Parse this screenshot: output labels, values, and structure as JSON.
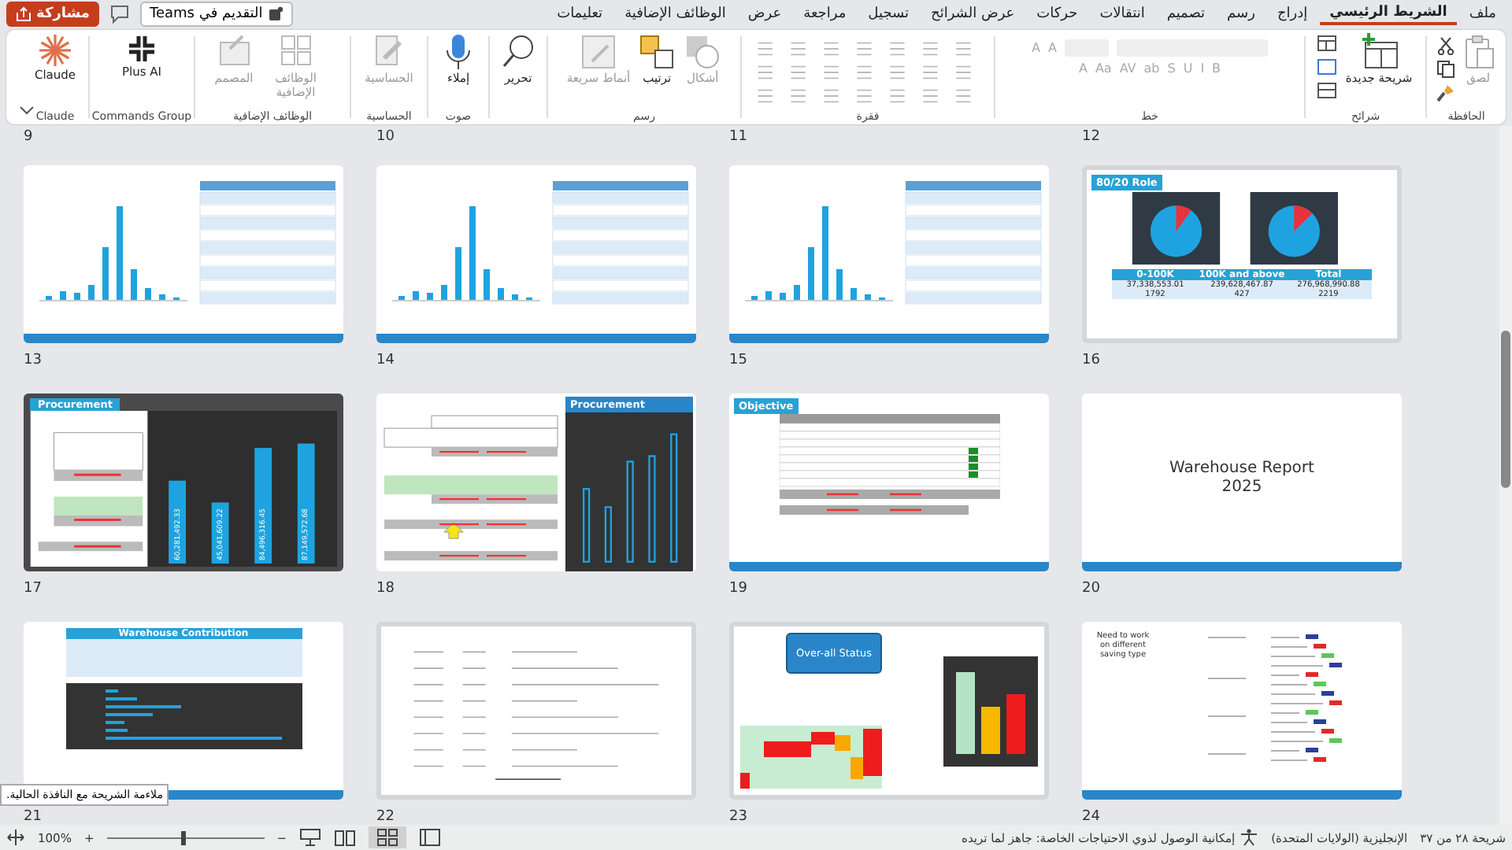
{
  "title_bar": {
    "share": "مشاركة",
    "teams": "التقديم في Teams"
  },
  "tabs": [
    {
      "label": "ملف",
      "selected": false
    },
    {
      "label": "الشريط الرئيسي",
      "selected": true
    },
    {
      "label": "إدراج",
      "selected": false
    },
    {
      "label": "رسم",
      "selected": false
    },
    {
      "label": "تصميم",
      "selected": false
    },
    {
      "label": "انتقالات",
      "selected": false
    },
    {
      "label": "حركات",
      "selected": false
    },
    {
      "label": "عرض الشرائح",
      "selected": false
    },
    {
      "label": "تسجيل",
      "selected": false
    },
    {
      "label": "مراجعة",
      "selected": false
    },
    {
      "label": "عرض",
      "selected": false
    },
    {
      "label": "الوظائف الإضافية",
      "selected": false
    },
    {
      "label": "تعليمات",
      "selected": false
    }
  ],
  "ribbon": {
    "groups": [
      {
        "label": "الحافظة",
        "items": [
          {
            "label": "لصق",
            "disabled": true
          }
        ]
      },
      {
        "label": "شرائح",
        "items": [
          {
            "label": "شريحة جديدة",
            "disabled": false
          }
        ]
      },
      {
        "label": "خط",
        "disabled": true,
        "size_buttons": [
          "A",
          "A"
        ],
        "format_buttons": [
          "B",
          "I",
          "U",
          "S",
          "ab",
          "AV",
          "Aa",
          "A"
        ]
      },
      {
        "label": "فقرة",
        "disabled": true
      },
      {
        "label": "رسم",
        "items": [
          {
            "label": "أشكال",
            "disabled": true
          },
          {
            "label": "ترتيب",
            "disabled": false
          },
          {
            "label": "أنماط سريعة",
            "disabled": true
          }
        ]
      },
      {
        "items": [
          {
            "label": "تحرير",
            "disabled": false
          }
        ]
      },
      {
        "label": "صوت",
        "items": [
          {
            "label": "إملاء",
            "disabled": false
          }
        ]
      },
      {
        "label": "الحساسية",
        "items": [
          {
            "label": "الحساسية",
            "disabled": true
          }
        ]
      },
      {
        "label": "الوظائف الإضافية",
        "items": [
          {
            "label": "الوظائف الإضافية",
            "disabled": true
          },
          {
            "label": "المصمم",
            "disabled": true
          }
        ]
      },
      {
        "label": "Commands Group",
        "items": [
          {
            "label": "Plus AI",
            "disabled": false
          }
        ]
      },
      {
        "label": "Claude",
        "items": [
          {
            "label": "Claude",
            "disabled": false
          }
        ]
      }
    ]
  },
  "top_row_numbers": [
    "12",
    "11",
    "10",
    "9"
  ],
  "slides": [
    {
      "number": "16",
      "kind": "role",
      "title": "80/20 Role",
      "headers": [
        "Total",
        "100K and above",
        "0-100K"
      ],
      "values": [
        "276,968,990.88",
        "239,628,467.87",
        "37,338,553.01"
      ],
      "counts": [
        "2219",
        "427",
        "1792"
      ]
    },
    {
      "number": "15",
      "kind": "bar_table"
    },
    {
      "number": "14",
      "kind": "bar_table"
    },
    {
      "number": "13",
      "kind": "bar_table"
    },
    {
      "number": "20",
      "kind": "title",
      "lines": [
        "Warehouse Report",
        "2025"
      ]
    },
    {
      "number": "19",
      "kind": "objective",
      "title": "Objective"
    },
    {
      "number": "18",
      "kind": "procurement_saving",
      "title": "Procurement"
    },
    {
      "number": "17",
      "kind": "procurement_dark",
      "title": "Procurement",
      "bar_labels": [
        "60,281,492.33",
        "45,041,609.22",
        "84,496,316.45",
        "87,149,572.68"
      ]
    },
    {
      "number": "24",
      "kind": "saving_list",
      "title": "Need to work on different saving type"
    },
    {
      "number": "23",
      "kind": "status",
      "title": "Over-all Status"
    },
    {
      "number": "22",
      "kind": "document"
    },
    {
      "number": "21",
      "kind": "contribution",
      "title": "Warehouse Contribution"
    }
  ],
  "tooltip": "ملاءمة الشريحة مع النافذة الحالية.",
  "status_bar": {
    "slide": "شريحة ٢٨ من ٣٧",
    "language": "الإنجليزية (الولايات المتحدة)",
    "accessibility": "إمكانية الوصول لذوي الاحتياجات الخاصة: جاهز لما تريده",
    "zoom": "100%",
    "zoom_in": "+",
    "zoom_out": "−",
    "zoom_slider": {
      "level": 0.48
    }
  }
}
